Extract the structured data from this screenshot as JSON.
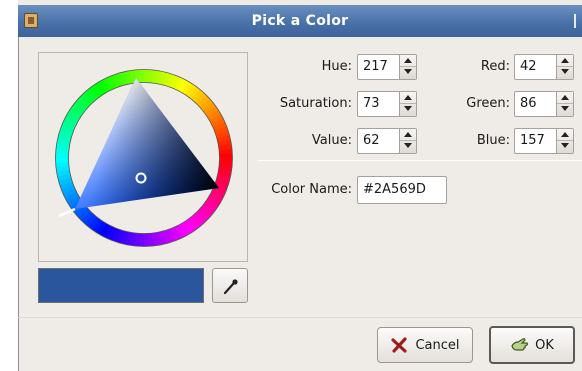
{
  "window": {
    "title": "Pick a Color"
  },
  "hsv": {
    "hue": {
      "label": "Hue:",
      "value": "217"
    },
    "saturation": {
      "label": "Saturation:",
      "value": "73"
    },
    "value": {
      "label": "Value:",
      "value": "62"
    }
  },
  "rgb": {
    "red": {
      "label": "Red:",
      "value": "42"
    },
    "green": {
      "label": "Green:",
      "value": "86"
    },
    "blue": {
      "label": "Blue:",
      "value": "157"
    }
  },
  "color_name": {
    "label": "Color Name:",
    "value": "#2A569D"
  },
  "current_color": "#2A569D",
  "buttons": {
    "cancel": "Cancel",
    "ok": "OK"
  },
  "icons": {
    "title": "app-icon",
    "picker": "eyedropper-icon",
    "cancel": "cancel-x-icon",
    "ok": "ok-hand-icon"
  }
}
